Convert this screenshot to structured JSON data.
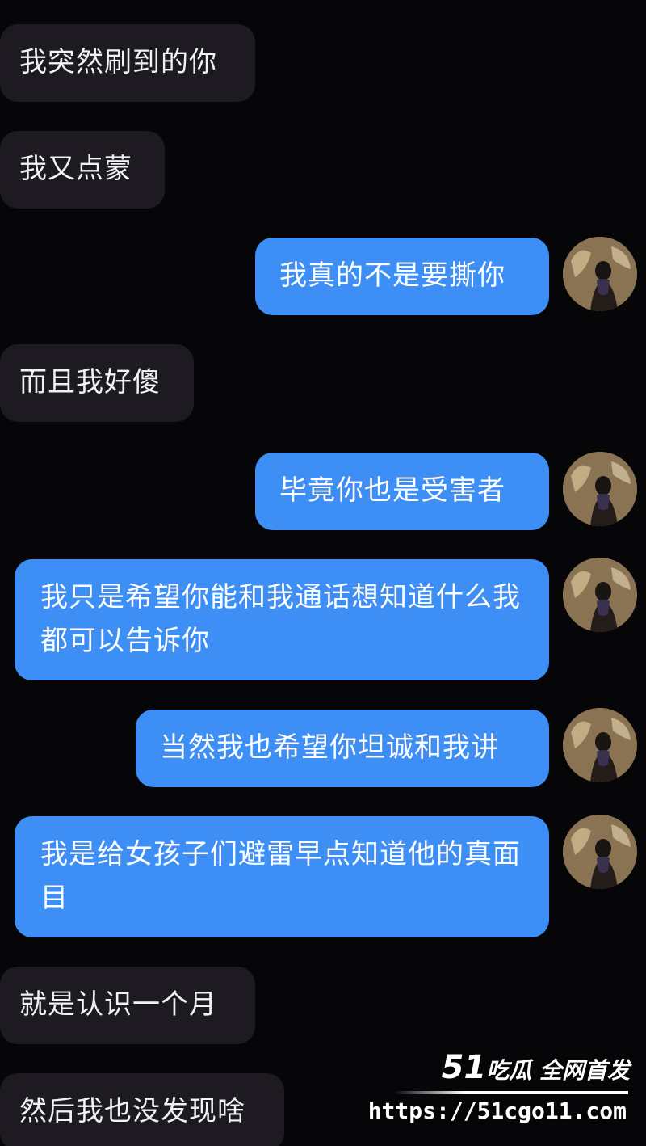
{
  "messages": [
    {
      "side": "incoming",
      "text": "我突然刷到的你"
    },
    {
      "side": "incoming",
      "text": "我又点蒙"
    },
    {
      "side": "outgoing",
      "text": "我真的不是要撕你"
    },
    {
      "side": "incoming",
      "text": "而且我好傻"
    },
    {
      "side": "outgoing",
      "text": "毕竟你也是受害者"
    },
    {
      "side": "outgoing",
      "text": "我只是希望你能和我通话想知道什么我都可以告诉你"
    },
    {
      "side": "outgoing",
      "text": "当然我也希望你坦诚和我讲"
    },
    {
      "side": "outgoing",
      "text": "我是给女孩子们避雷早点知道他的真面目"
    },
    {
      "side": "incoming",
      "text": "就是认识一个月"
    },
    {
      "side": "incoming",
      "text": "然后我也没发现啥"
    }
  ],
  "watermark": {
    "brand_num": "51",
    "brand_text": "吃瓜 全网首发",
    "url": "https://51cgo11.com"
  },
  "colors": {
    "background": "#060508",
    "incoming_bubble": "#1d1b21",
    "outgoing_bubble": "#3d8ef5"
  }
}
